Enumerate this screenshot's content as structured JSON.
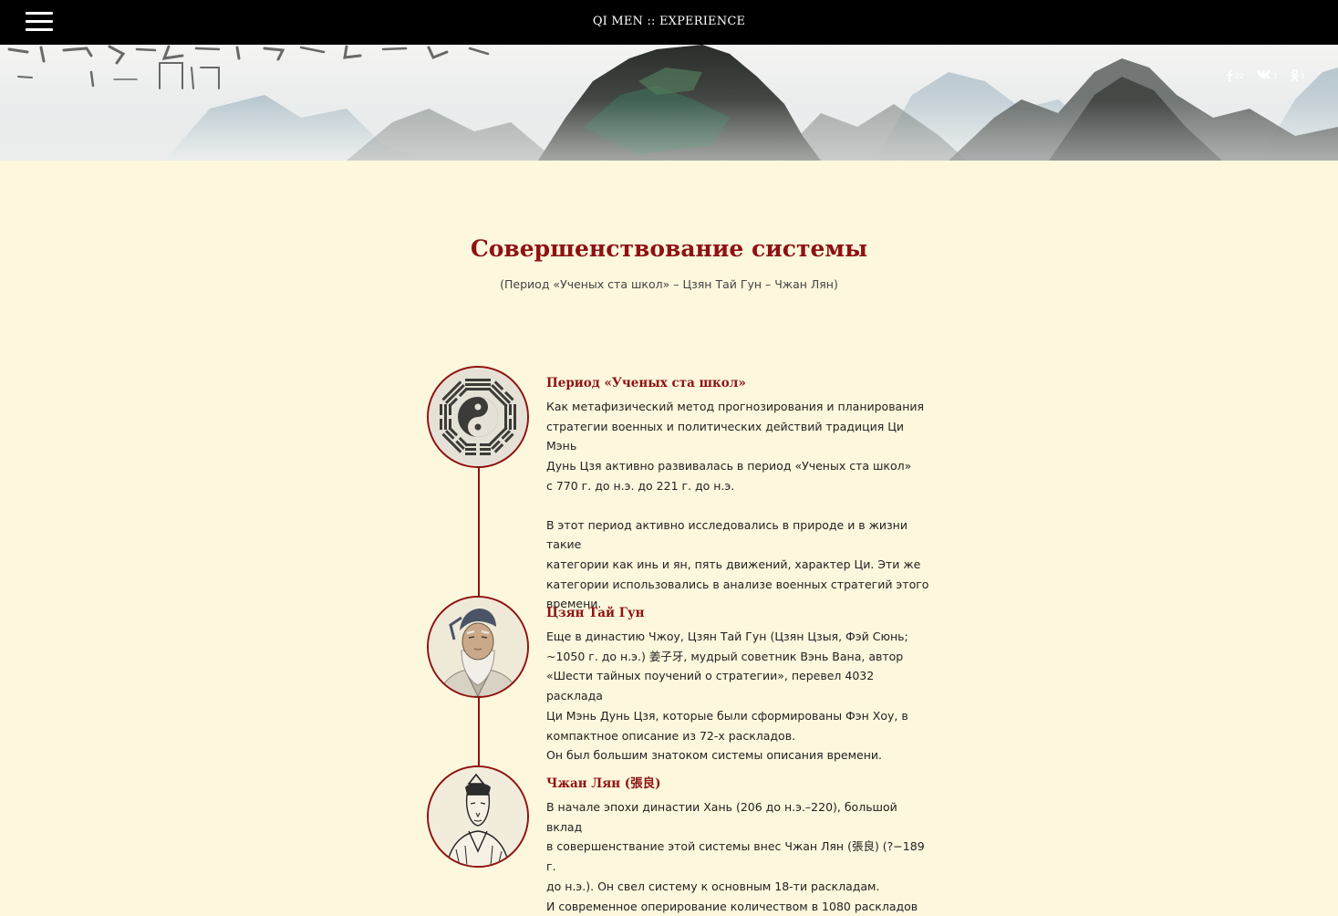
{
  "header": {
    "title": "QI MEN :: EXPERIENCE",
    "menu_icon": "hamburger-menu-icon"
  },
  "social": [
    {
      "network": "facebook",
      "icon": "facebook-icon",
      "count": "22"
    },
    {
      "network": "vkontakte",
      "icon": "vk-icon",
      "count": "1"
    },
    {
      "network": "odnoklassniki",
      "icon": "odnoklassniki-icon",
      "count": "1"
    }
  ],
  "section": {
    "title": "Совершенствование системы",
    "subtitle": "(Период «Ученых ста школ» – Цзян Тай Гун – Чжан Лян)"
  },
  "timeline": [
    {
      "icon": "yin-yang-bagua-icon",
      "title": "Период «Ученых ста школ»",
      "paragraphs": [
        [
          "Как метафизический метод прогнозирования и планирования",
          "стратегии военных и политических действий традиция Ци Мэнь",
          "Дунь Цзя активно развивалась в период «Ученых ста школ»",
          "с 770 г. до н.э. до 221 г. до н.э."
        ],
        [
          "В этот период активно исследовались в природе и в жизни такие",
          "категории как инь и ян, пять движений, характер Ци. Эти же",
          "категории использовались в анализе военных стратегий этого",
          "времени."
        ]
      ]
    },
    {
      "icon": "sage-portrait-icon",
      "title": "Цзян Тай Гун",
      "paragraphs": [
        [
          "Еще в династию Чжоу, Цзян Тай Гун (Цзян Цзыя, Фэй Сюнь;",
          "~1050 г. до н.э.) 姜子牙, мудрый советник Вэнь Вана, автор",
          "«Шести тайных поучений о стратегии», перевел 4032 расклада",
          "Ци Мэнь Дунь Цзя, которые были сформированы Фэн Хоу, в",
          "компактное описание из 72-х раскладов.",
          "Он был большим знатоком системы описания времени."
        ]
      ]
    },
    {
      "icon": "scholar-portrait-icon",
      "title": "Чжан Лян (張良)",
      "paragraphs": [
        [
          "В начале эпохи династии Хань (206 до н.э.–220), большой вклад",
          "в совершенствание этой системы внес Чжан Лян (張良) (?−189 г.",
          "до н.э.). Он свел систему к основным 18-ти раскладам.",
          "И современное оперирование количеством в 1080 раскладов"
        ]
      ]
    }
  ],
  "colors": {
    "accent": "#8e1212",
    "background": "#fdf7dd",
    "topbar": "#000000"
  }
}
